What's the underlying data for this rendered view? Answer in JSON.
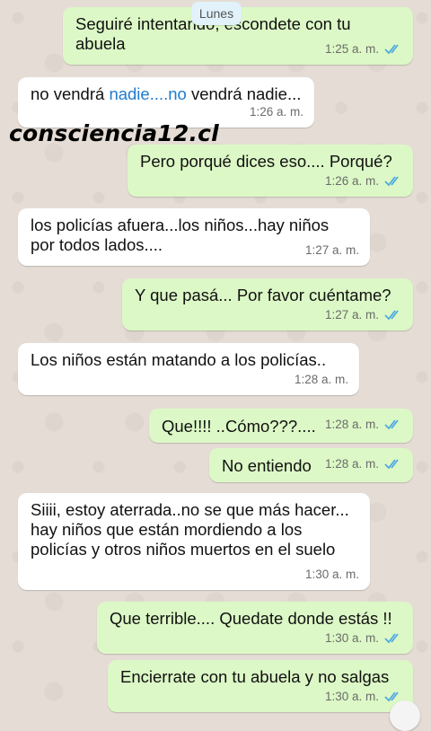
{
  "date_separator": "Lunes",
  "watermark": "consciencia12.cl",
  "colors": {
    "outgoing_bubble": "#dcf8c6",
    "incoming_bubble": "#ffffff",
    "chat_background": "#e5ddd5",
    "read_ticks": "#4fa9e0",
    "link": "#1f7bd0"
  },
  "messages": [
    {
      "direction": "out",
      "text": "Seguiré intentando, escondete con tu abuela",
      "time": "1:25 a. m.",
      "status": "read"
    },
    {
      "direction": "in",
      "text_pre": "no vendrá ",
      "text_link": "nadie....no",
      "text_post": " vendrá nadie...",
      "time": "1:26 a. m."
    },
    {
      "direction": "out",
      "text": "Pero porqué dices eso.... Porqué?",
      "time": "1:26 a. m.",
      "status": "read"
    },
    {
      "direction": "in",
      "text": "los policías afuera...los niños...hay niños por todos lados....",
      "time": "1:27 a. m."
    },
    {
      "direction": "out",
      "text": "Y que pasá... Por favor cuéntame?",
      "time": "1:27 a. m.",
      "status": "read"
    },
    {
      "direction": "in",
      "text": "Los niños están matando a los policías..",
      "time": "1:28 a. m."
    },
    {
      "direction": "out",
      "text": "Que!!!! ..Cómo???....",
      "time": "1:28 a. m.",
      "status": "read"
    },
    {
      "direction": "out",
      "text": "No entiendo",
      "time": "1:28 a. m.",
      "status": "read"
    },
    {
      "direction": "in",
      "text": "Siiii, estoy aterrada..no se que más hacer... hay niños que están mordiendo a los policías y otros niños muertos en el suelo",
      "time": "1:30 a. m."
    },
    {
      "direction": "out",
      "text": "Que terrible.... Quedate donde estás !!",
      "time": "1:30 a. m.",
      "status": "read"
    },
    {
      "direction": "out",
      "text": "Encierrate con tu abuela y no salgas",
      "time": "1:30 a. m.",
      "status": "read"
    }
  ]
}
